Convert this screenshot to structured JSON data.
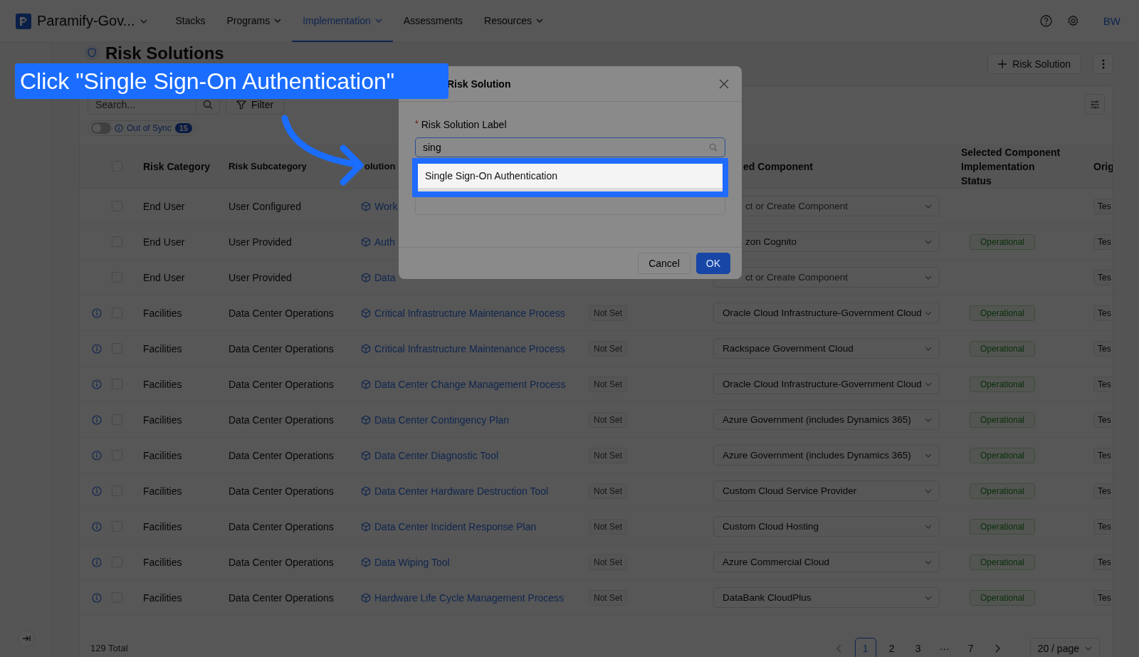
{
  "nav": {
    "workspace": "Paramify-Gov...",
    "items": [
      {
        "label": "Stacks",
        "selected": false,
        "has_menu": false
      },
      {
        "label": "Programs",
        "selected": false,
        "has_menu": true
      },
      {
        "label": "Implementation",
        "selected": true,
        "has_menu": true
      },
      {
        "label": "Assessments",
        "selected": false,
        "has_menu": false
      },
      {
        "label": "Resources",
        "selected": false,
        "has_menu": true
      }
    ],
    "user_initials": "BW"
  },
  "page": {
    "title": "Risk Solutions",
    "add_button": "Risk Solution"
  },
  "toolbar": {
    "search_placeholder": "Search...",
    "filter": "Filter",
    "out_of_sync": {
      "on": false,
      "label": "Out of Sync",
      "count": "15"
    }
  },
  "table": {
    "select_all_checked": false,
    "columns": [
      "Risk Category",
      "Risk Subcategory",
      "olution",
      "ed Component",
      "Selected Component Implementation Status",
      "Orig"
    ],
    "rows": [
      {
        "info": false,
        "checked": false,
        "category": "End User",
        "subcategory": "User Configured",
        "solution": "Work",
        "component": "ct or Create Component",
        "component_placeholder": true,
        "clipped": true,
        "origin": "Tes"
      },
      {
        "info": false,
        "checked": false,
        "category": "End User",
        "subcategory": "User Provided",
        "solution": "Auth",
        "component": "zon Cognito",
        "component_placeholder": false,
        "clipped": true,
        "impl_status": "Operational",
        "origin": "Tes"
      },
      {
        "info": false,
        "checked": false,
        "category": "End User",
        "subcategory": "User Provided",
        "solution": "Data",
        "component": "ct or Create Component",
        "component_placeholder": true,
        "clipped": true,
        "origin": "Tes"
      },
      {
        "info": true,
        "checked": false,
        "category": "Facilities",
        "subcategory": "Data Center Operations",
        "solution": "Critical Infrastructure Maintenance Process",
        "status": "Not Set",
        "component": "Oracle Cloud Infrastructure-Government Cloud",
        "component_placeholder": false,
        "clipped": false,
        "impl_status": "Operational",
        "origin": "Tes"
      },
      {
        "info": true,
        "checked": false,
        "category": "Facilities",
        "subcategory": "Data Center Operations",
        "solution": "Critical Infrastructure Maintenance Process",
        "status": "Not Set",
        "component": "Rackspace Government Cloud",
        "component_placeholder": false,
        "clipped": false,
        "impl_status": "Operational",
        "origin": "Tes"
      },
      {
        "info": true,
        "checked": false,
        "category": "Facilities",
        "subcategory": "Data Center Operations",
        "solution": "Data Center Change Management Process",
        "status": "Not Set",
        "component": "Oracle Cloud Infrastructure-Government Cloud",
        "component_placeholder": false,
        "clipped": false,
        "impl_status": "Operational",
        "origin": "Tes"
      },
      {
        "info": true,
        "checked": false,
        "category": "Facilities",
        "subcategory": "Data Center Operations",
        "solution": "Data Center Contingency Plan",
        "status": "Not Set",
        "component": "Azure Government (includes Dynamics 365)",
        "component_placeholder": false,
        "clipped": false,
        "impl_status": "Operational",
        "origin": "Tes"
      },
      {
        "info": true,
        "checked": false,
        "category": "Facilities",
        "subcategory": "Data Center Operations",
        "solution": "Data Center Diagnostic Tool",
        "status": "Not Set",
        "component": "Azure Government (includes Dynamics 365)",
        "component_placeholder": false,
        "clipped": false,
        "impl_status": "Operational",
        "origin": "Tes"
      },
      {
        "info": true,
        "checked": false,
        "category": "Facilities",
        "subcategory": "Data Center Operations",
        "solution": "Data Center Hardware Destruction Tool",
        "status": "Not Set",
        "component": "Custom Cloud Service Provider",
        "component_placeholder": false,
        "clipped": false,
        "impl_status": "Operational",
        "origin": "Tes"
      },
      {
        "info": true,
        "checked": false,
        "category": "Facilities",
        "subcategory": "Data Center Operations",
        "solution": "Data Center Incident Response Plan",
        "status": "Not Set",
        "component": "Custom Cloud Hosting",
        "component_placeholder": false,
        "clipped": false,
        "impl_status": "Operational",
        "origin": "Tes"
      },
      {
        "info": true,
        "checked": false,
        "category": "Facilities",
        "subcategory": "Data Center Operations",
        "solution": "Data Wiping Tool",
        "status": "Not Set",
        "component": "Azure Commercial Cloud",
        "component_placeholder": false,
        "clipped": false,
        "impl_status": "Operational",
        "origin": "Tes"
      },
      {
        "info": true,
        "checked": false,
        "category": "Facilities",
        "subcategory": "Data Center Operations",
        "solution": "Hardware Life Cycle Management Process",
        "status": "Not Set",
        "component": "DataBank CloudPlus",
        "component_placeholder": false,
        "clipped": false,
        "impl_status": "Operational",
        "origin": "Tes"
      }
    ]
  },
  "pagination": {
    "total": "129 Total",
    "pages": [
      {
        "label": "1",
        "selected": true
      },
      {
        "label": "2",
        "selected": false
      },
      {
        "label": "3",
        "selected": false
      },
      {
        "label": "···",
        "selected": false
      },
      {
        "label": "7",
        "selected": false
      }
    ],
    "page_size": "20 / page"
  },
  "modal": {
    "title": "Risk Solution",
    "required_mark": "*",
    "field_label": "Risk Solution Label",
    "value": "sing",
    "options": [
      {
        "label": "Single Sign-On Authentication",
        "selected": true
      }
    ],
    "cancel": "Cancel",
    "ok": "OK"
  },
  "callout": {
    "text": "Click \"Single Sign-On Authentication\""
  }
}
